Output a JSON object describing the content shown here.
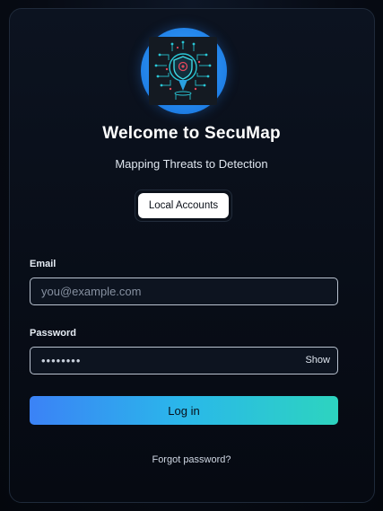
{
  "app": {
    "title": "Welcome to SecuMap",
    "subtitle": "Mapping Threats to Detection",
    "logo_icon": "shield-map-pin-icon",
    "colors": {
      "accent_blue": "#3b82f6",
      "accent_teal": "#2dd4bf",
      "logo_ring": "#1f7fe6",
      "background": "#070b14"
    }
  },
  "auth_tabs": {
    "active_label": "Local Accounts"
  },
  "form": {
    "email_label": "Email",
    "email_placeholder": "you@example.com",
    "email_value": "",
    "password_label": "Password",
    "password_value": "12345678",
    "show_label": "Show",
    "submit_label": "Log in",
    "forgot_label": "Forgot password?"
  }
}
